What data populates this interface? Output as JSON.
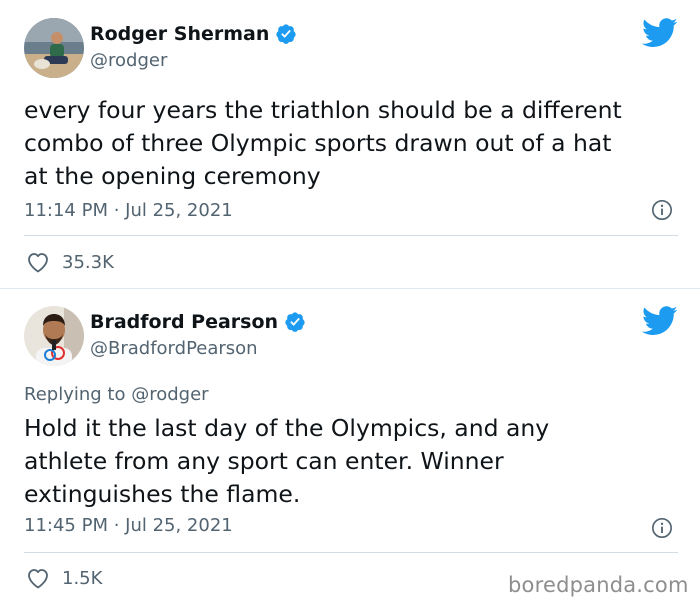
{
  "tweets": [
    {
      "name": "Rodger Sherman",
      "handle": "@rodger",
      "text_lines": [
        "every four years the triathlon should be a different",
        "combo of three Olympic sports drawn out of a hat",
        "at the opening ceremony"
      ],
      "timestamp": "11:14 PM · Jul 25, 2021",
      "likes": "35.3K"
    },
    {
      "name": "Bradford Pearson",
      "handle": "@BradfordPearson",
      "replying_prefix": "Replying to ",
      "replying_handle": "@rodger",
      "text_lines": [
        "Hold it the last day of the Olympics, and any",
        "athlete from any sport can enter. Winner",
        "extinguishes the flame."
      ],
      "timestamp": "11:45 PM · Jul 25, 2021",
      "likes": "1.5K"
    }
  ],
  "icons": {
    "verified": "verified-badge-icon",
    "bird": "twitter-bird-icon",
    "info": "info-icon",
    "like": "heart-icon"
  },
  "colors": {
    "twitter_blue": "#1d9bf0",
    "text": "#0f1419",
    "secondary": "#536471"
  },
  "watermark": "boredpanda.com"
}
